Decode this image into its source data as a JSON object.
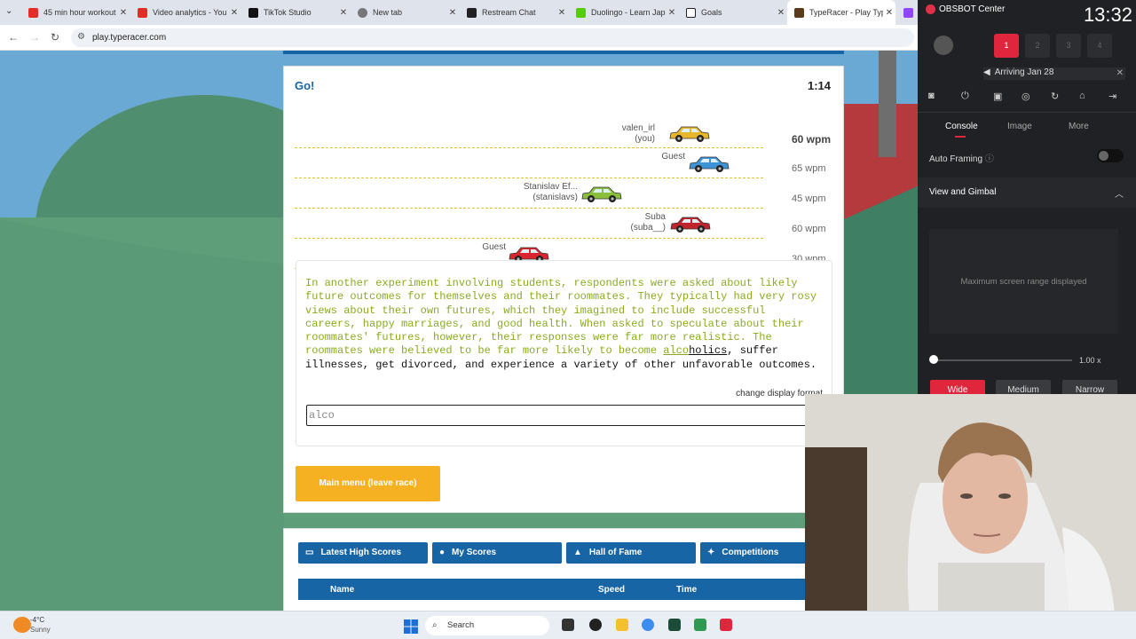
{
  "browser": {
    "tabs": [
      {
        "title": "45 min hour workout",
        "color": "#e52d27",
        "icon": "youtube-icon"
      },
      {
        "title": "Video analytics - You",
        "color": "#e52d27",
        "icon": "youtube-icon"
      },
      {
        "title": "TikTok Studio",
        "color": "#111111",
        "icon": "tiktok-icon"
      },
      {
        "title": "New tab",
        "color": "#555555",
        "icon": "globe-icon"
      },
      {
        "title": "Restream Chat",
        "color": "#222222",
        "icon": "restream-icon"
      },
      {
        "title": "Duolingo - Learn Jap",
        "color": "#58cc02",
        "icon": "duolingo-icon"
      },
      {
        "title": "Goals",
        "color": "#222222",
        "icon": "notion-icon"
      },
      {
        "title": "TypeRacer - Play Typ",
        "color": "#5a3b1a",
        "icon": "typeracer-icon"
      }
    ],
    "url": "play.typeracer.com"
  },
  "race": {
    "status": "Go!",
    "timer": "1:14",
    "racers": [
      {
        "name": "valen_irl",
        "sub": "(you)",
        "wpm": "60 wpm",
        "car_color": "#e8b62a",
        "progress": 0.71
      },
      {
        "name": "Guest",
        "sub": "",
        "wpm": "65 wpm",
        "car_color": "#3c94d6",
        "progress": 0.74
      },
      {
        "name": "Stanislav Ef...",
        "sub": "(stanislavs)",
        "wpm": "45 wpm",
        "car_color": "#8abf3c",
        "progress": 0.55
      },
      {
        "name": "Suba",
        "sub": "(suba__)",
        "wpm": "60 wpm",
        "car_color": "#c0242c",
        "progress": 0.72
      },
      {
        "name": "Guest",
        "sub": "",
        "wpm": "30 wpm",
        "car_color": "#d9262e",
        "progress": 0.43
      }
    ],
    "passage_typed": "In another experiment involving students, respondents were asked about likely future outcomes for themselves and their roommates. They typically had very rosy views about their own futures, which they imagined to include successful careers, happy marriages, and good health. When asked to speculate about their roommates' futures, however, their responses were far more realistic. The roommates were believed to be far more likely to become ",
    "passage_partial": "alco",
    "passage_word_rest": "holics",
    "passage_rest": ", suffer illnesses, get divorced, and experience a variety of other unfavorable outcomes.",
    "change_display": "change display format",
    "input_value": "alco",
    "main_menu_label": "Main menu (leave race)"
  },
  "scores": {
    "tabs": [
      "Latest High Scores",
      "My Scores",
      "Hall of Fame",
      "Competitions"
    ],
    "columns": {
      "name": "Name",
      "speed": "Speed",
      "time": "Time"
    }
  },
  "obsbot": {
    "title": "OBSBOT Center",
    "clock": "13:32",
    "slots": [
      "1",
      "2",
      "3",
      "4"
    ],
    "banner": "Arriving Jan 28",
    "tabs": [
      "Console",
      "Image",
      "More"
    ],
    "auto_framing": "Auto Framing",
    "section": "View and Gimbal",
    "range_text": "Maximum screen range displayed",
    "zoom": "1.00 x",
    "zoom_level": 0,
    "framing": [
      "Wide",
      "Medium",
      "Narrow"
    ]
  },
  "taskbar": {
    "temp": "-4°C",
    "condition": "Sunny",
    "search": "Search"
  },
  "colors": {
    "accent": "#1765a4",
    "typed": "#8aab21",
    "button": "#f5b121",
    "obs_red": "#e0263c"
  }
}
